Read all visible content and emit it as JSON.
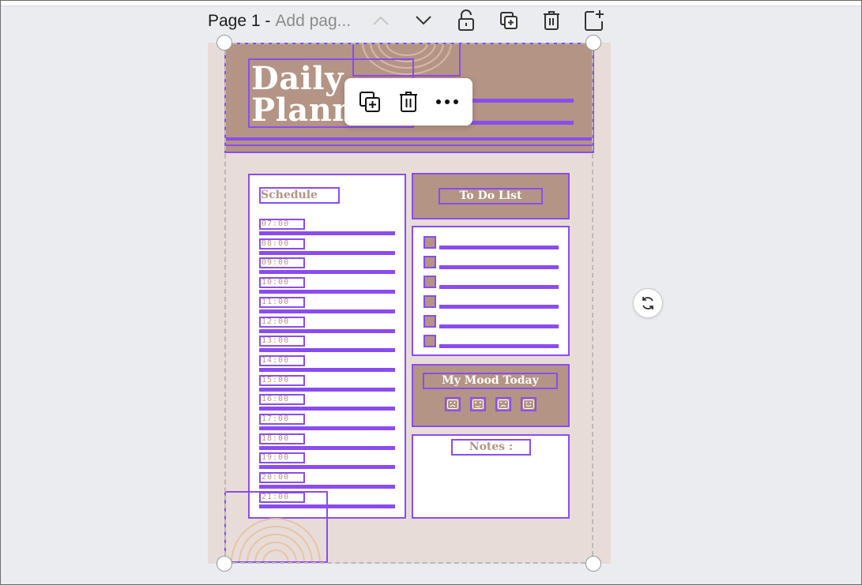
{
  "page_header": {
    "title": "Page 1 -",
    "add_title_placeholder": "Add pag..."
  },
  "toolbar_icons": [
    "chevron-up-icon",
    "chevron-down-icon",
    "unlock-icon",
    "duplicate-page-icon",
    "trash-icon",
    "add-page-icon"
  ],
  "floating_toolbar": {
    "icons": [
      "duplicate-icon",
      "trash-icon",
      "more-icon"
    ]
  },
  "planner": {
    "title_line1": "Daily",
    "title_line2": "Planne",
    "schedule_label": "Schedule",
    "times": [
      "07:00",
      "08:00",
      "09:00",
      "10:00",
      "11:00",
      "12:00",
      "13:00",
      "14:00",
      "15:00",
      "16:00",
      "17:00",
      "18:00",
      "19:00",
      "20:00",
      "21:00"
    ],
    "todo_label": "To Do List",
    "todo_items_count": 6,
    "mood_label": "My Mood Today",
    "mood_faces": [
      "sad-face-icon",
      "laughing-face-icon",
      "frown-face-icon",
      "smile-face-icon"
    ],
    "notes_label": "Notes :"
  },
  "colors": {
    "accent_purple": "#8a4cf0",
    "tan": "#b49484",
    "page_bg": "#e8dcd8",
    "arc": "#e6c4a8"
  }
}
